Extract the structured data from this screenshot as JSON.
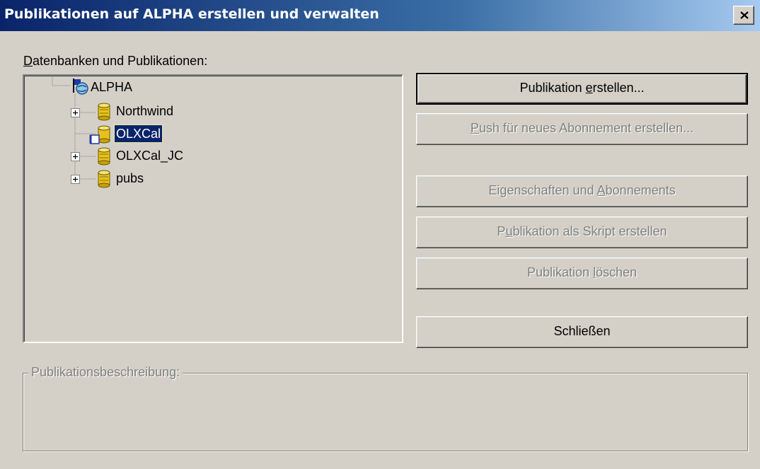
{
  "window": {
    "title": "Publikationen auf ALPHA erstellen und verwalten",
    "close_icon": "close-icon"
  },
  "tree": {
    "caption_accel": "D",
    "caption_rest": "atenbanken und Publikationen:",
    "root": {
      "label": "ALPHA",
      "icon": "server-icon"
    },
    "nodes": [
      {
        "label": "Northwind",
        "icon": "database-icon",
        "expandable": true,
        "selected": false
      },
      {
        "label": "OLXCal",
        "icon": "database-publication-icon",
        "expandable": false,
        "selected": true
      },
      {
        "label": "OLXCal_JC",
        "icon": "database-icon",
        "expandable": true,
        "selected": false
      },
      {
        "label": "pubs",
        "icon": "database-icon",
        "expandable": true,
        "selected": false
      }
    ]
  },
  "buttons": {
    "create": {
      "pre": "Publikation ",
      "accel": "e",
      "post": "rstellen...",
      "enabled": true,
      "default": true
    },
    "push": {
      "pre": "",
      "accel": "P",
      "post": "ush für neues Abonnement erstellen...",
      "enabled": false
    },
    "properties": {
      "pre": "Eigenschaften und ",
      "accel": "A",
      "post": "bonnements",
      "enabled": false
    },
    "script": {
      "pre": "P",
      "accel": "u",
      "post": "blikation als Skript erstellen",
      "enabled": false
    },
    "delete": {
      "pre": "Publikation ",
      "accel": "l",
      "post": "öschen",
      "enabled": false
    },
    "close": {
      "pre": "Schließen",
      "accel": "",
      "post": "",
      "enabled": true
    }
  },
  "description": {
    "legend": "Publikationsbeschreibung:"
  },
  "colors": {
    "face": "#d4d0c8",
    "title_start": "#0a246a",
    "title_end": "#a6caf0",
    "selection": "#0a246a",
    "disabled_text": "#808080",
    "db_icon": "#e8c020"
  }
}
